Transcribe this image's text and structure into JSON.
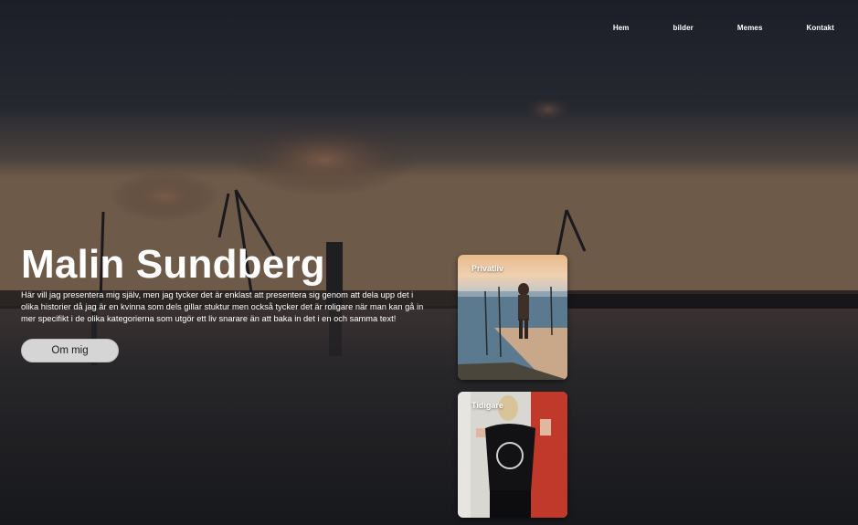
{
  "nav": {
    "items": [
      "Hem",
      "bilder",
      "Memes",
      "Kontakt"
    ]
  },
  "hero": {
    "title": "Malin Sundberg",
    "intro": "Här vill jag presentera mig själv, men jag tycker det är enklast att presentera sig genom att dela upp det i olika historier då jag är en kvinna som dels gillar stuktur men också tycker det är roligare när man kan gå in mer specifikt i de olika kategorierna som utgör ett liv snarare än att baka in det i en och samma text!",
    "button_label": "Om mig"
  },
  "cards": [
    {
      "label": "Privatliv"
    },
    {
      "label": "Tidigare"
    }
  ],
  "colors": {
    "sky_top": "#1d2029",
    "horizon": "#6a5849",
    "water": "#23242a",
    "button_bg": "#d5d5d5"
  }
}
